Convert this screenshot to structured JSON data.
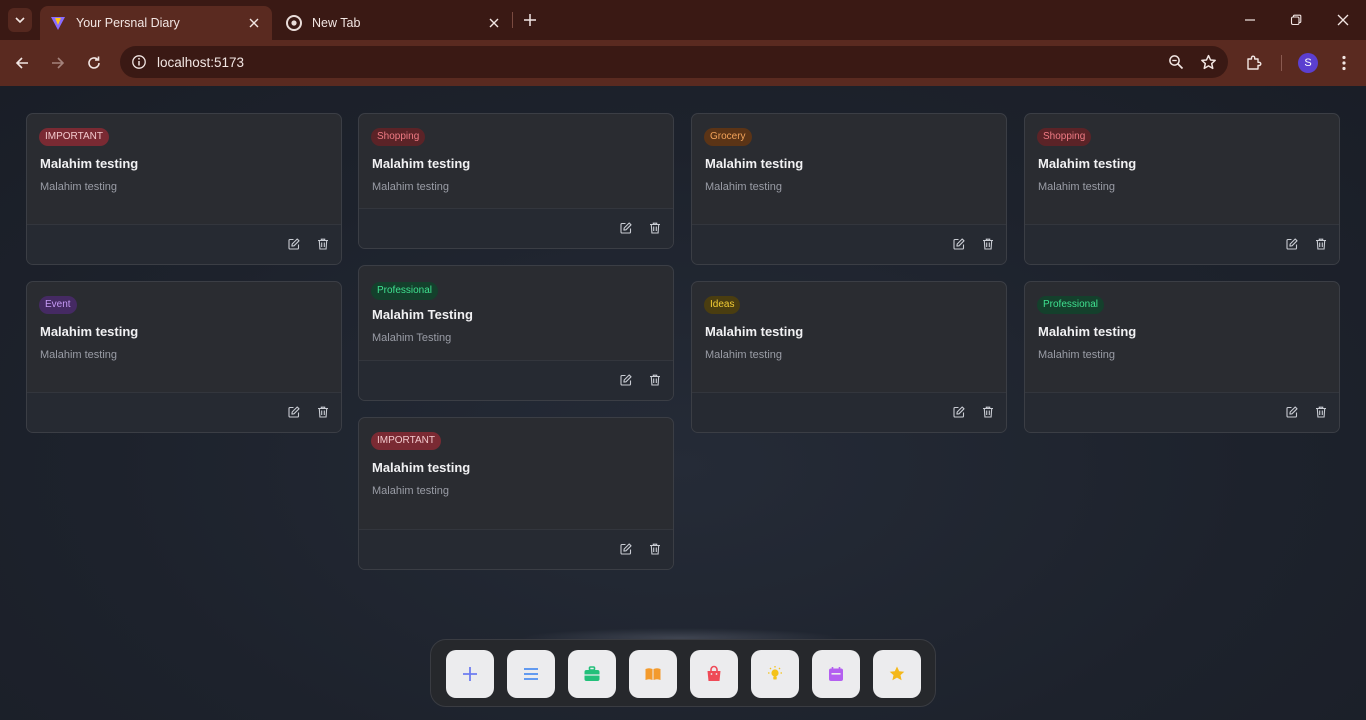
{
  "browser": {
    "tabs": [
      {
        "title": "Your Persnal Diary",
        "active": true
      },
      {
        "title": "New Tab",
        "active": false
      }
    ],
    "url": "localhost:5173",
    "profile_initial": "S"
  },
  "notes": [
    {
      "badge": "IMPORTANT",
      "category": "important",
      "title": "Malahim testing",
      "body": "Malahim testing"
    },
    {
      "badge": "Shopping",
      "category": "shopping",
      "title": "Malahim testing",
      "body": "Malahim testing"
    },
    {
      "badge": "Grocery",
      "category": "grocery",
      "title": "Malahim testing",
      "body": "Malahim testing"
    },
    {
      "badge": "Shopping",
      "category": "shopping",
      "title": "Malahim testing",
      "body": "Malahim testing"
    },
    {
      "badge": "Event",
      "category": "event",
      "title": "Malahim testing",
      "body": "Malahim testing"
    },
    {
      "badge": "Professional",
      "category": "professional",
      "title": "Malahim Testing",
      "body": "Malahim Testing"
    },
    {
      "badge": "Ideas",
      "category": "ideas",
      "title": "Malahim testing",
      "body": "Malahim testing"
    },
    {
      "badge": "Professional",
      "category": "professional",
      "title": "Malahim testing",
      "body": "Malahim testing"
    },
    {
      "badge": "IMPORTANT",
      "category": "important",
      "title": "Malahim testing",
      "body": "Malahim testing"
    }
  ],
  "dock": [
    {
      "icon": "plus-icon",
      "color": "#6d7cf0"
    },
    {
      "icon": "list-icon",
      "color": "#4f8ff0"
    },
    {
      "icon": "briefcase-icon",
      "color": "#22c07a"
    },
    {
      "icon": "book-icon",
      "color": "#f39a2c"
    },
    {
      "icon": "shopping-bag-icon",
      "color": "#ef4a57"
    },
    {
      "icon": "lightbulb-icon",
      "color": "#f4c21a"
    },
    {
      "icon": "calendar-icon",
      "color": "#b45ff0"
    },
    {
      "icon": "star-icon",
      "color": "#f4b81a"
    }
  ],
  "colors": {
    "chrome_dark": "#3a1914",
    "chrome_toolbar": "#5a2a20",
    "page_bg": "#1d222c",
    "card_bg": "#2a2c31"
  }
}
